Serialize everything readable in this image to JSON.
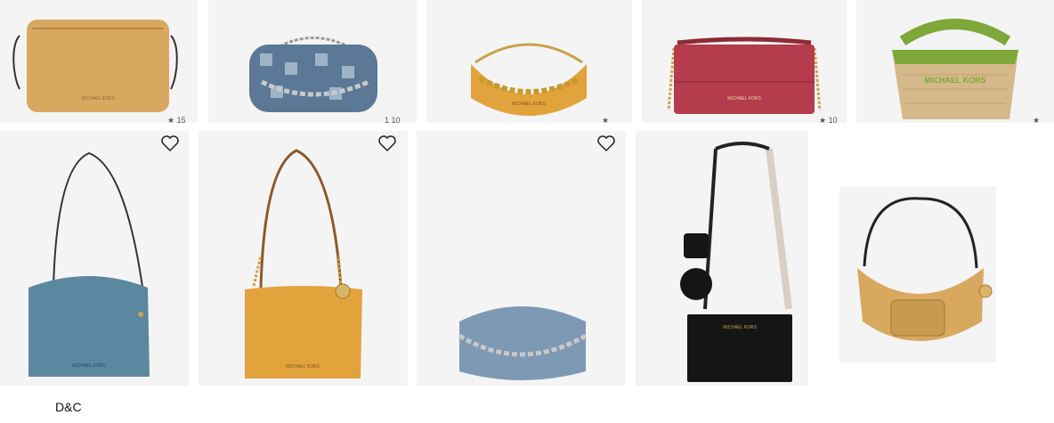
{
  "grid": {
    "row1": [
      {
        "name": "tan crossbody camera bag"
      },
      {
        "name": "denim monogram chain shoulder bag",
        "rating_fragment": "1 10"
      },
      {
        "name": "marigold signature logo chain shoulder bag"
      },
      {
        "name": "red signature logo chain crossbody"
      },
      {
        "name": "straw tote with green handles",
        "logo_text": "MICHAEL KORS"
      }
    ],
    "row2": [
      {
        "name": "blue suede crossbody hobo"
      },
      {
        "name": "marigold logo chain crossbody"
      },
      {
        "name": "blue suede chain shoulder bag"
      },
      {
        "name": "black crossbody with pouches"
      },
      {
        "name": "tan logo shoulder bag with pocket"
      }
    ]
  },
  "footer": {
    "label": "D&C"
  },
  "colors": {
    "tile_bg": "#f4f4f4",
    "tan": "#d9a860",
    "marigold": "#e2a23c",
    "denim": "#5b7896",
    "red": "#b43c4c",
    "straw": "#d6b98a",
    "green": "#7ea83a",
    "blue_suede": "#5b87a0",
    "light_blue_suede": "#7e99b4",
    "black": "#151515"
  },
  "icons": {
    "wishlist": "heart-outline-icon"
  }
}
